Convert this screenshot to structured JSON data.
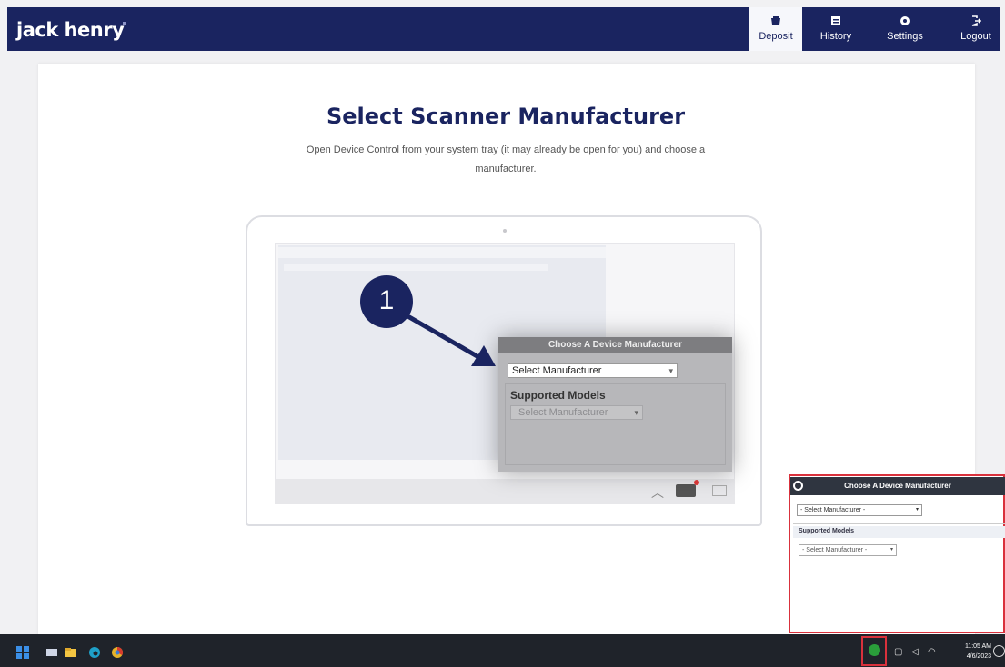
{
  "header": {
    "logo": "jack henry",
    "nav": [
      {
        "label": "Deposit",
        "icon": "deposit-icon",
        "active": true
      },
      {
        "label": "History",
        "icon": "history-icon",
        "active": false
      },
      {
        "label": "Settings",
        "icon": "gear-icon",
        "active": false
      },
      {
        "label": "Logout",
        "icon": "logout-icon",
        "active": false
      }
    ]
  },
  "main": {
    "title": "Select Scanner Manufacturer",
    "subtitle_line1": "Open Device Control from your system tray (it may already be open for you) and choose a",
    "subtitle_line2": "manufacturer."
  },
  "illustration": {
    "step_number": "1",
    "dialog_title": "Choose A Device Manufacturer",
    "select_value": "Select Manufacturer",
    "supported_label": "Supported Models",
    "models_value": "Select Manufacturer"
  },
  "device_dialog": {
    "title": "Choose A Device Manufacturer",
    "select_value": "- Select Manufacturer -",
    "supported_label": "Supported Models",
    "models_value": "- Select Manufacturer -"
  },
  "taskbar": {
    "time": "11:05 AM",
    "date": "4/6/2023"
  },
  "colors": {
    "navy": "#1a2460",
    "highlight_red": "#d9313c",
    "taskbar": "#1f232a"
  }
}
